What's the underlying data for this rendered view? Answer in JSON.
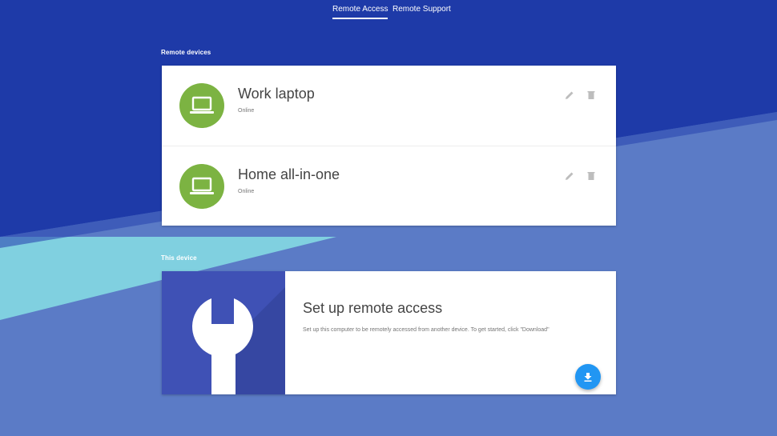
{
  "tabs": [
    {
      "label": "Remote Access",
      "active": true
    },
    {
      "label": "Remote Support",
      "active": false
    }
  ],
  "remote_devices": {
    "section_label": "Remote devices",
    "devices": [
      {
        "name": "Work laptop",
        "status": "Online",
        "icon": "laptop-icon"
      },
      {
        "name": "Home all-in-one",
        "status": "Online",
        "icon": "laptop-icon"
      }
    ]
  },
  "this_device": {
    "section_label": "This device",
    "title": "Set up remote access",
    "description": "Set up this computer to be remotely accessed from another device. To get started, click \"Download\"",
    "action_icon": "download-icon",
    "graphic_icon": "wrench-icon"
  },
  "colors": {
    "background_dark": "#1e3aa8",
    "background_light": "#5b7bc6",
    "accent_cyan": "#80d0e0",
    "device_green": "#7cb342",
    "setup_panel": "#3f51b5",
    "fab_blue": "#2196f3"
  }
}
